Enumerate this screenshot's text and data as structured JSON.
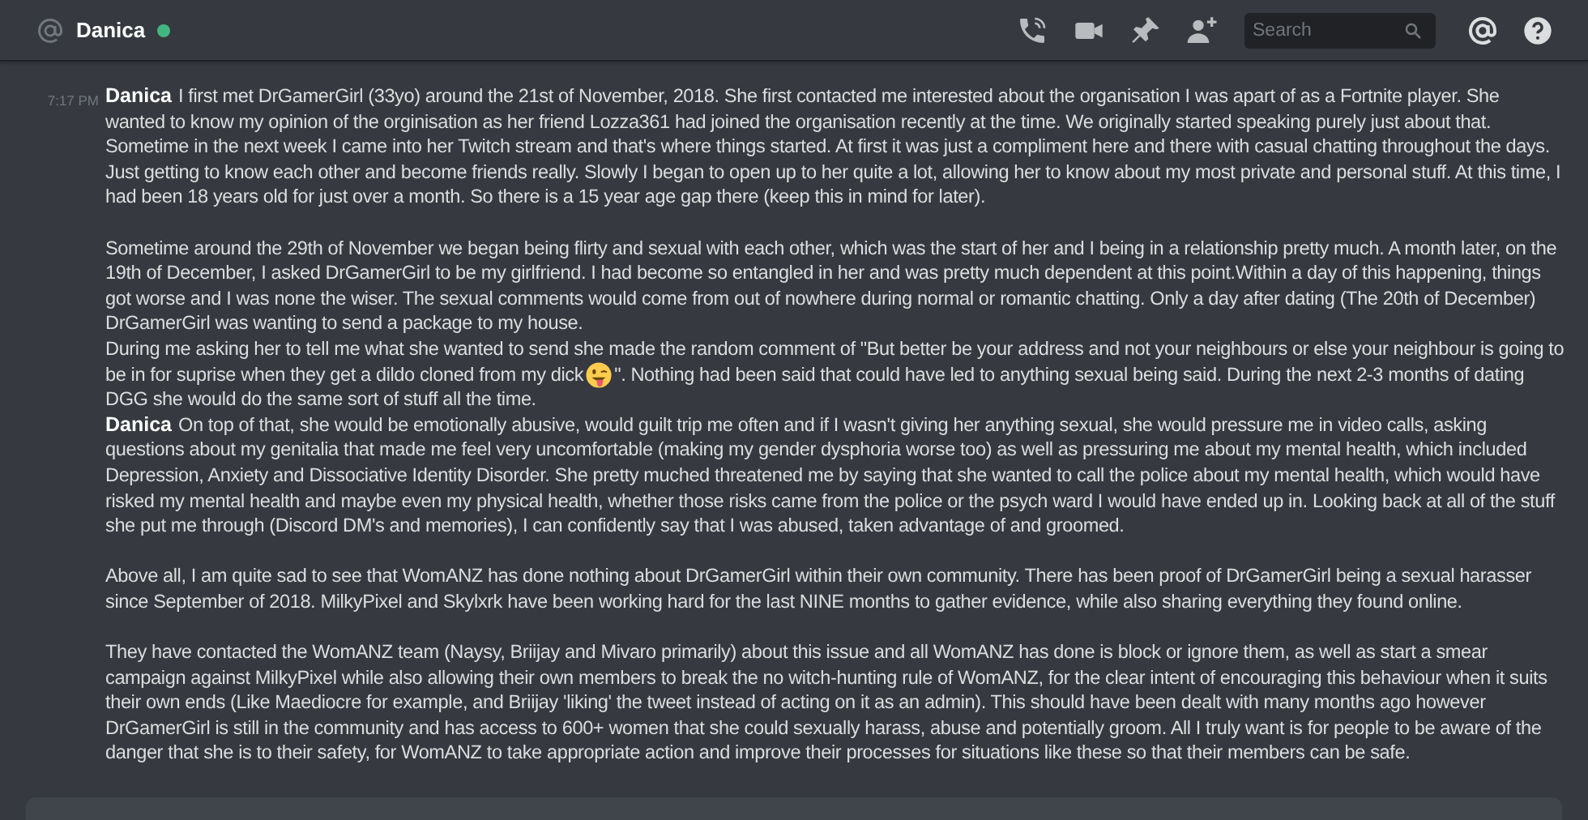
{
  "header": {
    "title": "Danica",
    "status": {
      "color": "#43b581"
    },
    "search": {
      "placeholder": "Search"
    }
  },
  "messages": [
    {
      "author": "Danica",
      "time": "7:17 PM",
      "paragraphs": [
        {
          "lead": "I first met DrGamerGirl (33yo) around the 21st of November, 2018. She first contacted me interested about the organisation I was apart of as a Fortnite player. She",
          "text": "wanted to know my opinion of the orginisation as her friend Lozza361 had joined the organisation recently at the time. We originally started speaking purely just about that. Sometime in the next week I came into her Twitch stream and that's where things started. At first it was just a compliment here and there with casual chatting throughout the days. Just getting to know each other and become friends really. Slowly I began to open up to her quite a lot, allowing her to know about my most private and personal stuff. At this time, I had been 18 years old for just over a month. So there is a 15 year age gap there (keep this in mind for later)."
        },
        {
          "text": "Sometime around the 29th of November we began being flirty and sexual with each other, which was the start of her and I being in a relationship pretty much. A month later, on the 19th of December, I asked DrGamerGirl to be my girlfriend. I had become so entangled in her and was pretty much dependent at this point.Within a day of this happening, things got worse and I was none the wiser. The sexual comments would come from out of nowhere during normal or romantic chatting. Only a day after dating (The 20th of December) DrGamerGirl was wanting to send a package to my house."
        },
        {
          "lines": [
            {
              "text": "During me asking her to tell me what she wanted to send she made the random comment of \"But better be your address and not your neighbours or else your neighbour is going to"
            },
            {
              "text": "be in for suprise when they get a dildo cloned from my dick",
              "text_after": "\". Nothing had been said that could have led to anything sexual being said. During the next 2-3 months of dating"
            },
            {
              "text": "DGG she would do the same sort of stuff all the time."
            }
          ]
        }
      ]
    },
    {
      "author": "Danica",
      "paragraphs": [
        {
          "lead": "On top of that, she would be emotionally abusive, would guilt trip me often and if I wasn't giving her anything sexual, she would pressure me in video calls, asking",
          "text": "questions about my genitalia that made me feel very uncomfortable (making my gender dysphoria worse too) as well as pressuring me about my mental health, which included Depression, Anxiety and Dissociative Identity Disorder. She pretty muched threatened me by saying that she wanted to call the police about my mental health, which would have risked my mental health and maybe even my physical health, whether those risks came from the police or the psych ward I would have ended up in. Looking back at all of the stuff she put me through (Discord DM's and memories), I can confidently say that I was abused, taken advantage of and groomed."
        },
        {
          "text": "Above all, I am quite sad to see that WomANZ has done nothing about DrGamerGirl within their own community. There has been proof of DrGamerGirl being a sexual harasser since September of 2018. MilkyPixel and Skylxrk have been working hard for the last NINE months to gather evidence, while also sharing everything they found online."
        },
        {
          "text": "They have contacted the WomANZ team (Naysy, Briijay and Mivaro primarily) about this issue and all WomANZ has done is block or ignore them, as well as start a smear campaign against MilkyPixel while also allowing their own members to break the no witch-hunting rule of WomANZ, for the clear intent of encouraging this behaviour when it suits their own ends (Like Maediocre for example, and Briijay 'liking' the tweet instead of acting on it as an admin). This should have been dealt with many months ago however DrGamerGirl is still in the community and has access to 600+ women that she could sexually harass, abuse and potentially groom. All I truly want is for people to be aware of the danger that she is to their safety, for WomANZ to take appropriate action and improve their processes for situations like these so that their members can be safe."
        }
      ]
    }
  ]
}
